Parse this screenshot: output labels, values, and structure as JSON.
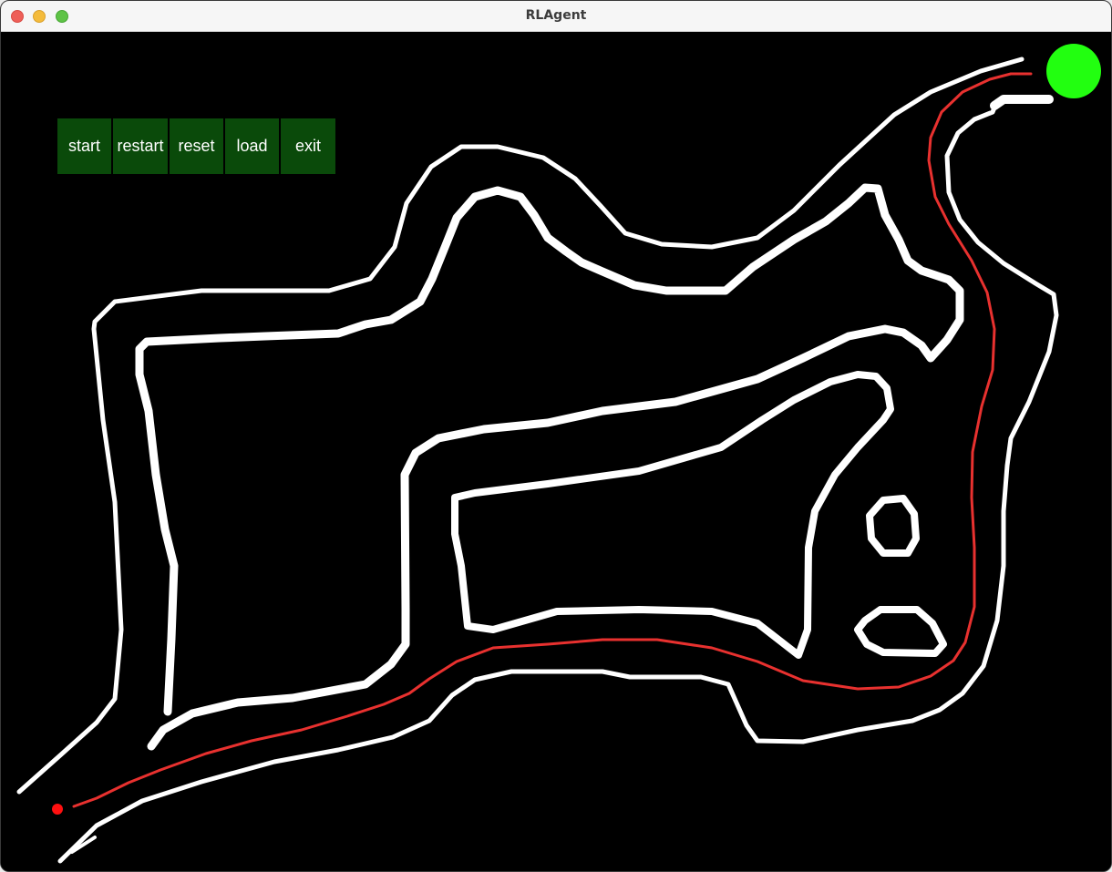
{
  "window": {
    "title": "RLAgent"
  },
  "toolbar": {
    "buttons": [
      {
        "label": "start"
      },
      {
        "label": "restart"
      },
      {
        "label": "reset"
      },
      {
        "label": "load"
      },
      {
        "label": "exit"
      }
    ]
  },
  "colors": {
    "background": "#000000",
    "track_walls": "#ffffff",
    "agent_path": "#e8312f",
    "agent": "#ff1010",
    "goal": "#22ff10",
    "button_bg": "#0a4a0a",
    "button_text": "#ffffff"
  },
  "scene": {
    "agent_icon": "red-dot",
    "goal_icon": "green-circle"
  }
}
